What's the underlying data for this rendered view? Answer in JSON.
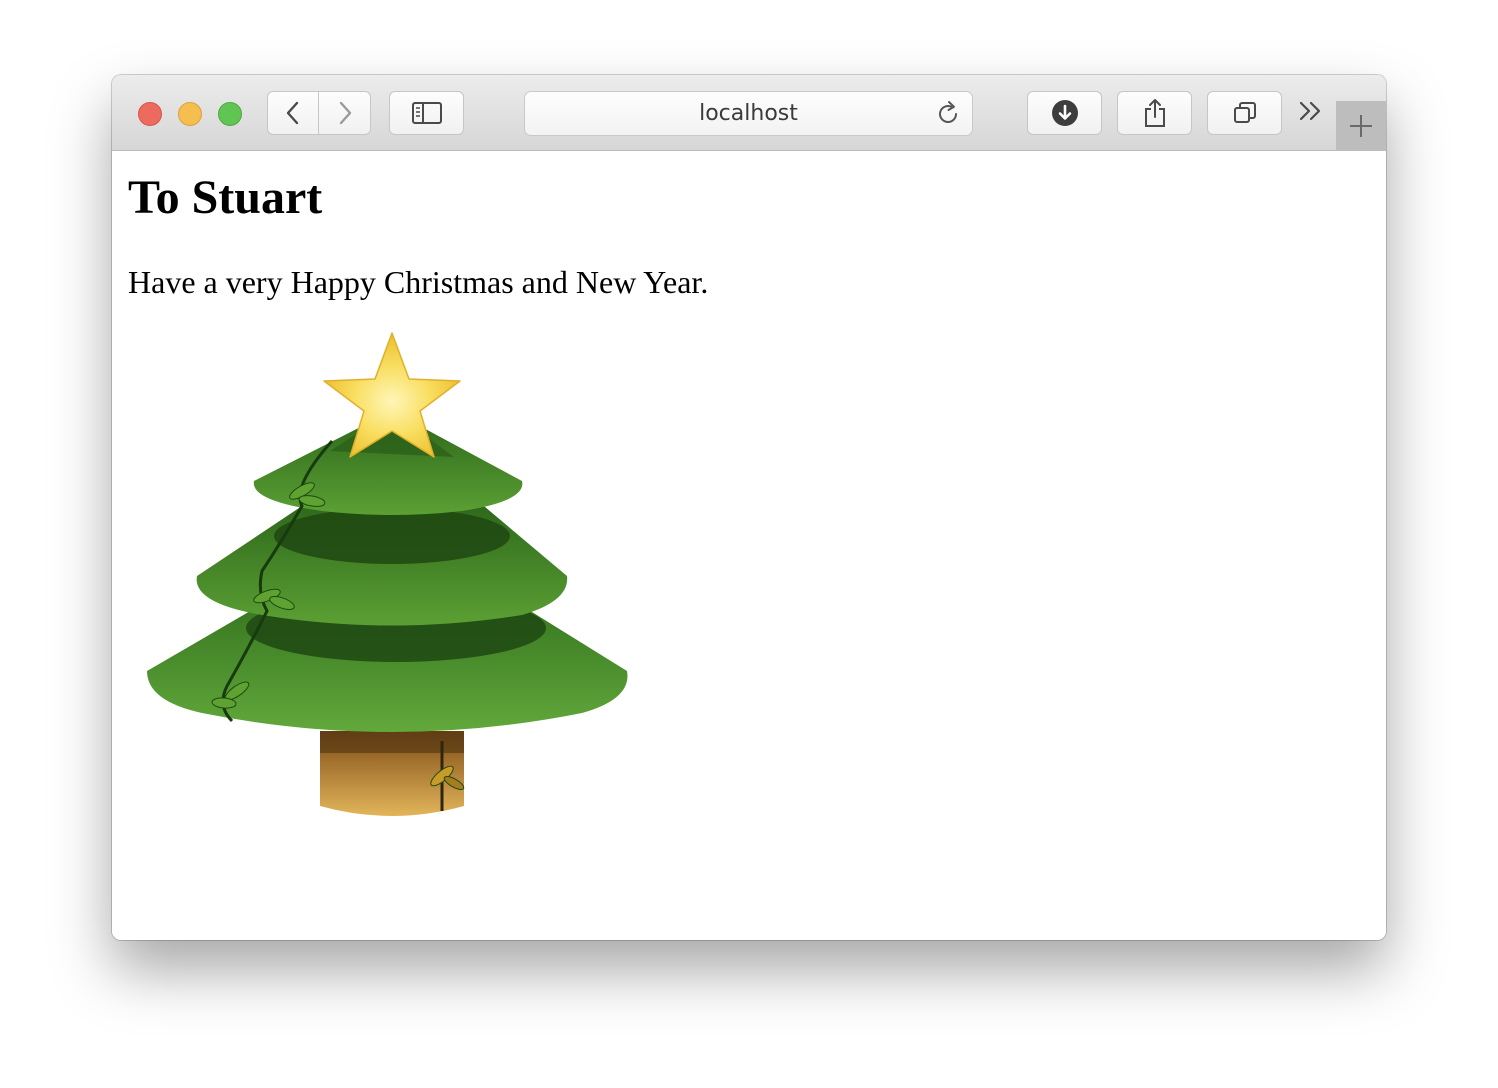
{
  "browser": {
    "address": "localhost",
    "icons": {
      "back": "chevron-left-icon",
      "forward": "chevron-right-icon",
      "sidebar": "sidebar-icon",
      "reload": "reload-icon",
      "download": "download-icon",
      "share": "share-icon",
      "tabs": "tabs-overview-icon",
      "overflow": "double-chevron-right-icon",
      "new_tab": "plus-icon"
    },
    "traffic_colors": {
      "close": "#ec6a5e",
      "minimize": "#f4bf4f",
      "zoom": "#61c554"
    }
  },
  "page": {
    "heading": "To Stuart",
    "message": "Have a very Happy Christmas and New Year.",
    "image": "christmas-tree-with-star",
    "colors": {
      "tree_green": "#3f8a2a",
      "star_yellow": "#f7d64f",
      "trunk_brown": "#c9953f"
    }
  }
}
